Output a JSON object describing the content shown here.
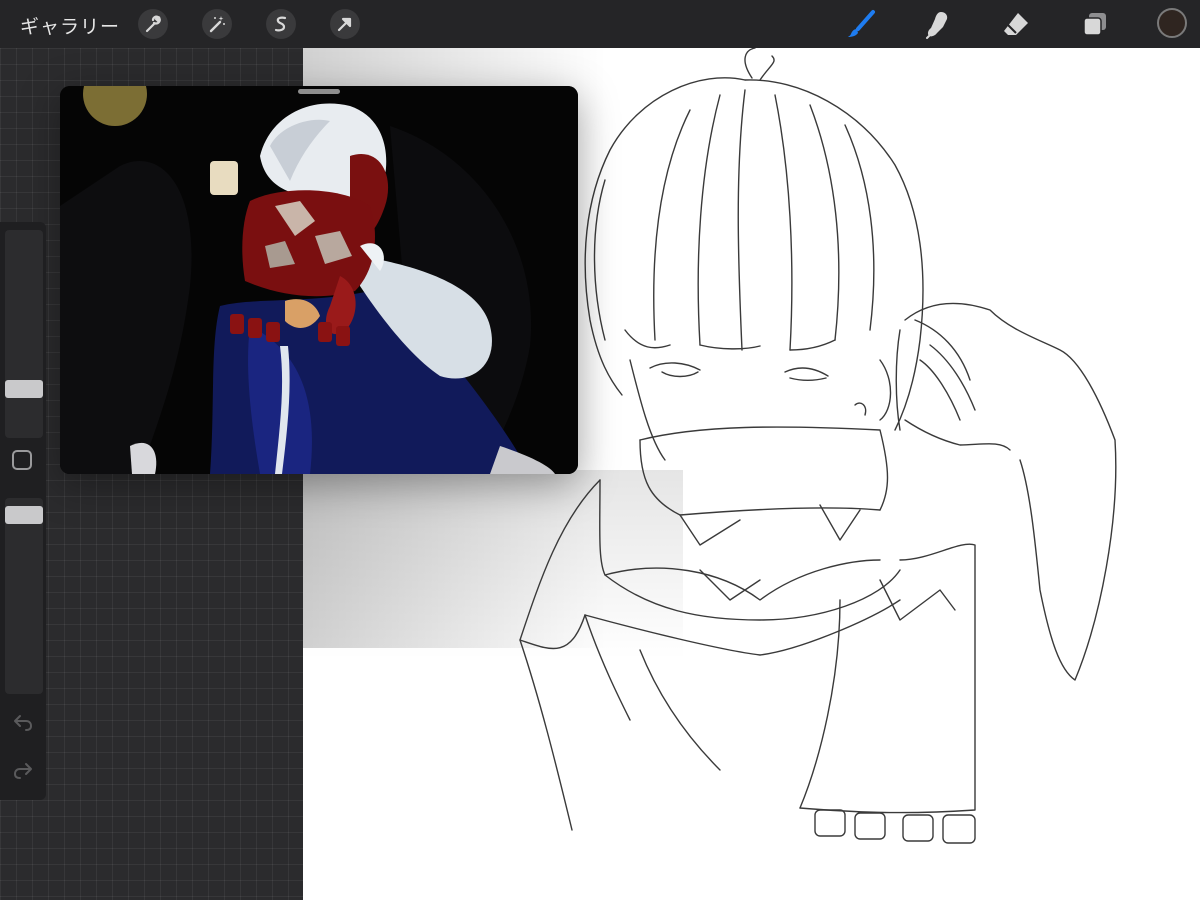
{
  "app": {
    "gallery_label": "ギャラリー"
  },
  "toolbar": {
    "left_tools": [
      {
        "name": "actions",
        "icon": "wrench-icon"
      },
      {
        "name": "adjustments",
        "icon": "magic-wand-icon"
      },
      {
        "name": "selection",
        "icon": "selection-s-icon"
      },
      {
        "name": "transform",
        "icon": "arrow-cursor-icon"
      }
    ],
    "right_tools": [
      {
        "name": "paint",
        "icon": "brush-icon",
        "active": true
      },
      {
        "name": "smudge",
        "icon": "smudge-finger-icon"
      },
      {
        "name": "erase",
        "icon": "eraser-icon"
      },
      {
        "name": "layers",
        "icon": "layers-icon"
      }
    ],
    "active_color": "#2f2520",
    "accent_color": "#1e7cf0"
  },
  "sidebar": {
    "brush_size_level": 0.37,
    "opacity_level": 0.97,
    "undo_icon": "undo-arrow-icon",
    "redo_icon": "redo-arrow-icon"
  },
  "reference_window": {
    "content": "3d-character-render",
    "background": "#050505"
  },
  "canvas": {
    "background": "#ffffff",
    "content": "pencil-line-sketch"
  }
}
